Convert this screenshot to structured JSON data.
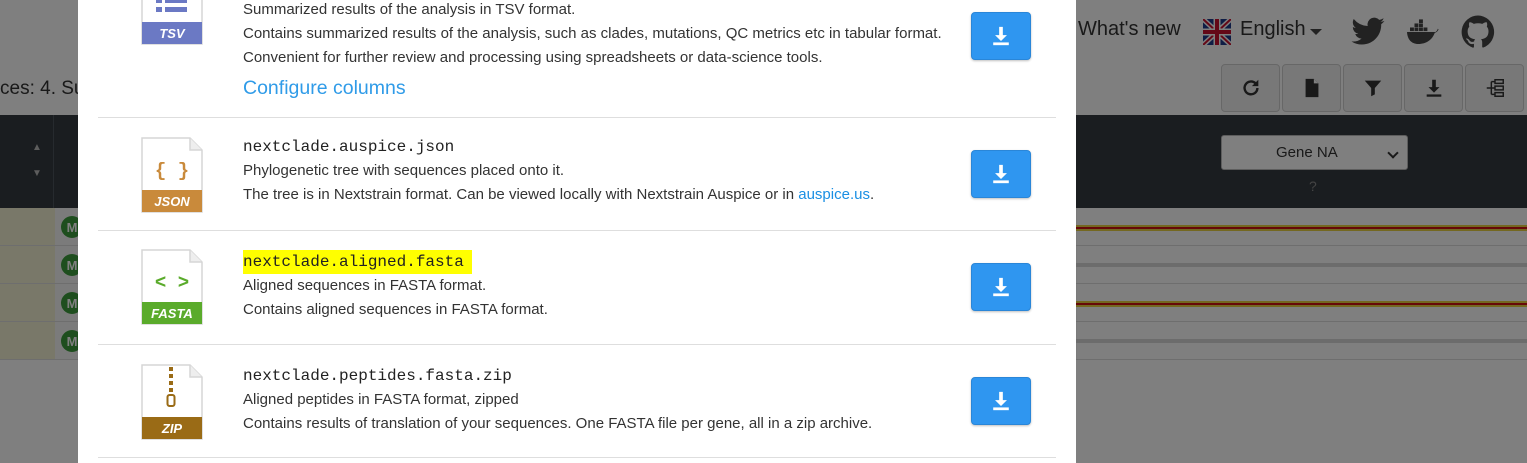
{
  "background": {
    "nav": {
      "whats_new": "What's new",
      "language": "English"
    },
    "sequences_text": "ces: 4. Su",
    "gene_select": "Gene NA",
    "gene_help": "?",
    "row_badges": [
      "M",
      "M",
      "M",
      "M"
    ]
  },
  "modal": {
    "items": [
      {
        "badge": "TSV",
        "badge_color": "#6b79c4",
        "desc1": "Summarized results of the analysis in TSV format.",
        "desc2": "Contains summarized results of the analysis, such as clades, mutations, QC metrics etc in tabular format. Convenient for further review and processing using spreadsheets or data-science tools.",
        "link": "Configure columns"
      },
      {
        "filename": "nextclade.auspice.json",
        "badge": "JSON",
        "badge_color": "#c98a3b",
        "glyph": "{ }",
        "desc1": "Phylogenetic tree with sequences placed onto it.",
        "desc2": "The tree is in Nextstrain format. Can be viewed locally with Nextstrain Auspice or in",
        "desc2_link": "auspice.us",
        "desc2_tail": "."
      },
      {
        "filename": "nextclade.aligned.fasta",
        "badge": "FASTA",
        "badge_color": "#5aab2b",
        "glyph": "< >",
        "highlight_color": "#ffff00",
        "desc1": "Aligned sequences in FASTA format.",
        "desc2": "Contains aligned sequences in FASTA format."
      },
      {
        "filename": "nextclade.peptides.fasta.zip",
        "badge": "ZIP",
        "badge_color": "#9a6b16",
        "desc1": "Aligned peptides in FASTA format, zipped",
        "desc2": "Contains results of translation of your sequences. One FASTA file per gene, all in a zip archive."
      }
    ]
  },
  "icons": {
    "download": "download-icon",
    "refresh": "refresh-icon",
    "file": "file-icon",
    "filter": "filter-icon",
    "tree": "tree-icon"
  }
}
